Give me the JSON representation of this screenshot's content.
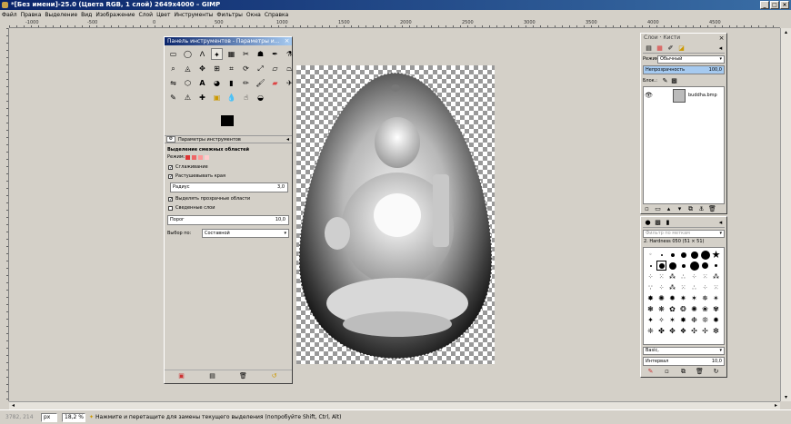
{
  "window": {
    "title": "*[Без имени]-25.0 (Цвета RGB, 1 слой) 2649x4000 – GIMP"
  },
  "menu": [
    "Файл",
    "Правка",
    "Выделение",
    "Вид",
    "Изображение",
    "Слой",
    "Цвет",
    "Инструменты",
    "Фильтры",
    "Окна",
    "Справка"
  ],
  "ruler": {
    "ticks": [
      "-1000",
      "-500",
      "0",
      "500",
      "1000",
      "1500",
      "2000",
      "2500",
      "3000",
      "3500",
      "4000",
      "4500"
    ]
  },
  "toolbox": {
    "title": "Панель инструментов - Параметры и...",
    "tool_options_tab": "Параметры инструментов",
    "section_title": "Выделение смежных областей",
    "mode_label": "Режим:",
    "antialias": {
      "label": "Сглаживание",
      "checked": true
    },
    "feather": {
      "label": "Растушевывать края",
      "checked": true
    },
    "radius": {
      "label": "Радиус",
      "value": "3,0"
    },
    "transparent": {
      "label": "Выделять прозрачные области",
      "checked": true
    },
    "merged": {
      "label": "Сведенные слои",
      "checked": false
    },
    "threshold": {
      "label": "Порог",
      "value": "10,0"
    },
    "select_by": {
      "label": "Выбор по:",
      "value": "Составной"
    }
  },
  "layers": {
    "tabs": [
      "Слои",
      "Кисти"
    ],
    "mode_label": "Режим:",
    "mode_value": "Обычный",
    "opacity_label": "Непрозрачность",
    "opacity_value": "100,0",
    "lock_label": "Блок.:",
    "items": [
      {
        "name": "buddha.bmp",
        "visible": true
      }
    ]
  },
  "brushes": {
    "filter_placeholder": "Фильтр по меткам",
    "current": "2. Hardness 050 (51 × 51)",
    "preset_value": "Basic,",
    "spacing_label": "Интервал",
    "spacing_value": "10,0"
  },
  "status": {
    "coords": "3782, 214",
    "unit": "px",
    "zoom": "18,2 %",
    "message": "Нажмите и перетащите для замены текущего выделения (попробуйте Shift, Ctrl, Alt)"
  },
  "colors": {
    "title_active": "#0a246a",
    "panel_bg": "#d4d0c8",
    "accent": "#a6caf0"
  }
}
